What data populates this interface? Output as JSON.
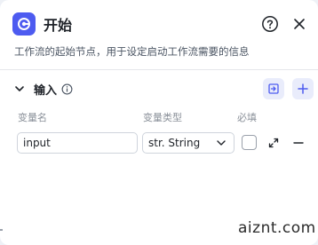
{
  "header": {
    "title": "开始",
    "description": "工作流的起始节点，用于设定启动工作流需要的信息"
  },
  "section": {
    "title": "输入"
  },
  "columns": {
    "name": "变量名",
    "type": "变量类型",
    "required": "必填"
  },
  "rows": [
    {
      "name": "input",
      "type": "str. String",
      "required": false
    }
  ],
  "watermark": "aiznt.com",
  "colors": {
    "accent": "#4d5bf0",
    "accent_bg": "#e9ecfb"
  }
}
